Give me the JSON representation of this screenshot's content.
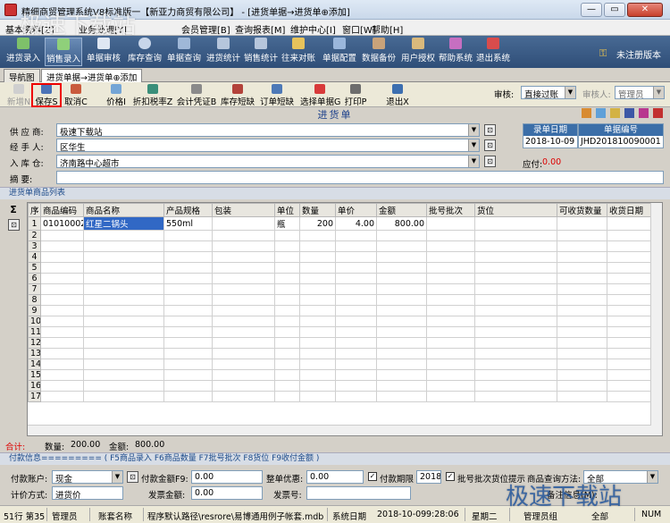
{
  "window": {
    "title": "精细商贸管理系统V8标准版一【新亚力商贸有限公司】 - [进货单据→进货单⊕添加]",
    "min": "—",
    "restore": "▭",
    "close": "✕"
  },
  "menu": [
    "基本资料[Z]",
    "业务处理[Y]",
    "会员管理[B]",
    "查询报表[M]",
    "维护中心[I]",
    "窗口[W]",
    "帮助[H]"
  ],
  "toolbar": {
    "buttons": [
      "进货录入",
      "销售录入",
      "单据审核",
      "库存查询",
      "单据查询",
      "进货统计",
      "销售统计",
      "往来对账",
      "单据配置",
      "数据备份",
      "用户授权",
      "帮助系统",
      "退出系统"
    ],
    "unregistered": "未注册版本"
  },
  "tabs": [
    "导航图",
    "进货单据→进货单⊕添加"
  ],
  "subtoolbar": {
    "buttons": [
      "新增N",
      "保存S",
      "取消C",
      "价格I",
      "折扣税率Z",
      "会计凭证B",
      "库存短缺",
      "订单短缺",
      "选择单据G",
      "打印P",
      "退出X"
    ],
    "review_label": "审核:",
    "review_value": "直接过账",
    "reviewer_label": "审核人:",
    "reviewer_value": "管理员"
  },
  "form": {
    "title": "进货单",
    "supplier_label": "供 应 商:",
    "supplier_value": "极速下载站",
    "handler_label": "经 手 人:",
    "handler_value": "区华生",
    "warehouse_label": "入 库 仓:",
    "warehouse_value": "济南路中心超市",
    "memo_label": "摘    要:",
    "memo_value": "",
    "record_date_label": "录单日期",
    "record_date_value": "2018-10-09",
    "doc_no_label": "单据编号",
    "doc_no_value": "JHD201810090001",
    "payable_label": "应付:",
    "payable_value": "0.00"
  },
  "grid": {
    "caption": "进货单商品列表",
    "columns": [
      "序",
      "商品编码",
      "商品名称",
      "产品规格",
      "包装",
      "单位",
      "数量",
      "单价",
      "金额",
      "批号批次",
      "货位",
      "可收货数量",
      "收货日期"
    ],
    "rows": [
      {
        "no": "1",
        "code": "01010002",
        "name": "红星二锅头",
        "spec": "550ml",
        "pack": "",
        "unit": "瓶",
        "qty": "200",
        "price": "4.00",
        "amount": "800.00"
      }
    ],
    "empty_row_numbers": [
      "2",
      "3",
      "4",
      "5",
      "6",
      "7",
      "8",
      "9",
      "10",
      "11",
      "12",
      "13",
      "14",
      "15",
      "16",
      "17"
    ]
  },
  "totals": {
    "label": "合计:",
    "qty_label": "数量:",
    "qty_value": "200.00",
    "amount_label": "金额:",
    "amount_value": "800.00"
  },
  "payment": {
    "header": "付款信息========= ( F5商品录入  F6商品数量  F7批号批次  F8货位  F9收付金额 )",
    "account_label": "付款账户:",
    "account_value": "现金",
    "pay_amount_label": "付款金额F9:",
    "pay_amount_value": "0.00",
    "discount_label": "整单优惠:",
    "discount_value": "0.00",
    "due_label": "付款期限",
    "due_value": "2018-",
    "hint_label": "批号批次货位提示",
    "query_method_label": "商品查询方法:",
    "query_method_value": "全部",
    "price_method_label": "计价方式:",
    "price_method_value": "进货价",
    "invoice_amount_label": "发票金额:",
    "invoice_amount_value": "0.00",
    "invoice_no_label": "发票号:",
    "invoice_no_value": "",
    "notes_label": "备注信息(M):"
  },
  "status": {
    "row": "51行 第35",
    "user": "管理员",
    "account_name": "账套名称",
    "path": "程序默认路径\\resrore\\易博通用例子帐套.mdb",
    "sys_date_label": "系统日期",
    "sys_date": "2018-10-09",
    "time": "9:28:06",
    "weekday": "星期二",
    "all": "全部",
    "role": "管理员组",
    "num": "NUM"
  },
  "watermarks": [
    "极速下载站",
    "极速下载站"
  ]
}
